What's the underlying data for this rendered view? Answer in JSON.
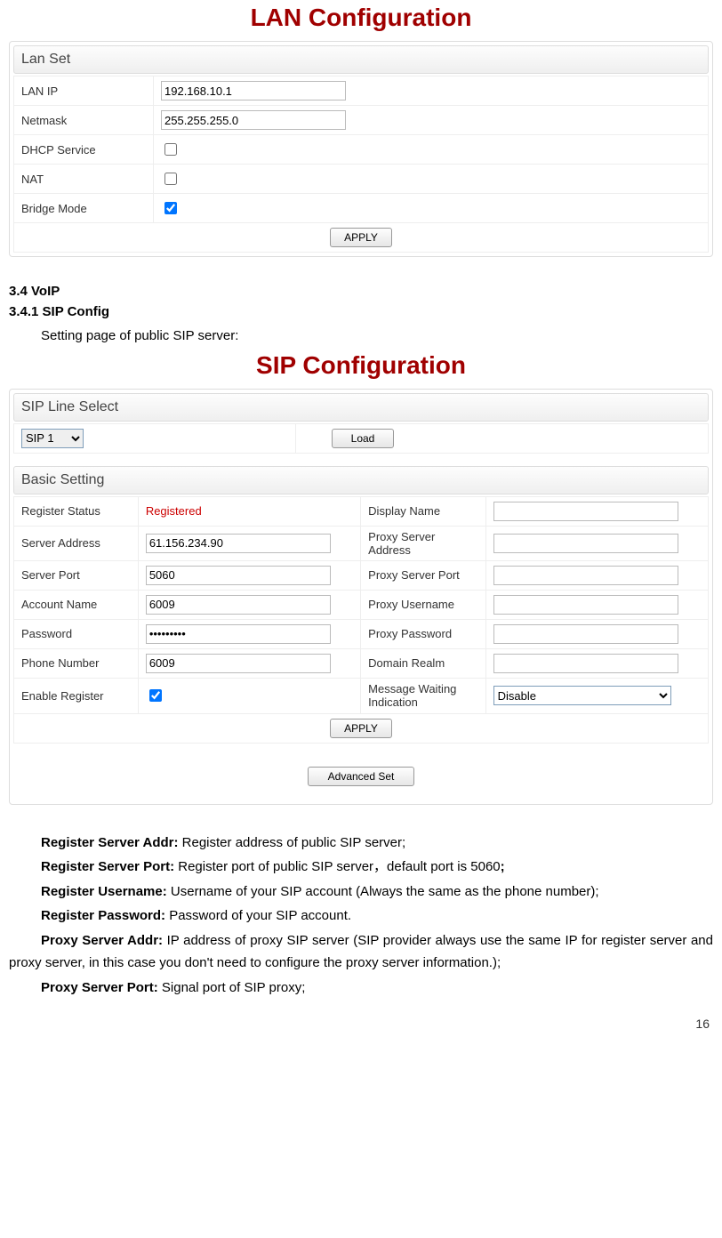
{
  "lan": {
    "title": "LAN Configuration",
    "section": "Lan Set",
    "rows": {
      "lan_ip_label": "LAN IP",
      "lan_ip_value": "192.168.10.1",
      "netmask_label": "Netmask",
      "netmask_value": "255.255.255.0",
      "dhcp_label": "DHCP Service",
      "nat_label": "NAT",
      "bridge_label": "Bridge Mode"
    },
    "apply": "APPLY"
  },
  "headings": {
    "h34": "3.4 VoIP",
    "h341": "3.4.1 SIP Config",
    "h341_sub": "Setting page of public SIP server:"
  },
  "sip": {
    "title": "SIP Configuration",
    "line_select_section": "SIP Line Select",
    "sip_select_value": "SIP 1",
    "load_btn": "Load",
    "basic_section": "Basic Setting",
    "left": {
      "register_status_label": "Register Status",
      "register_status_value": "Registered",
      "server_address_label": "Server Address",
      "server_address_value": "61.156.234.90",
      "server_port_label": "Server Port",
      "server_port_value": "5060",
      "account_name_label": "Account Name",
      "account_name_value": "6009",
      "password_label": "Password",
      "password_value": "•••••••••",
      "phone_number_label": "Phone Number",
      "phone_number_value": "6009",
      "enable_register_label": "Enable Register"
    },
    "right": {
      "display_name_label": "Display Name",
      "display_name_value": "",
      "proxy_server_addr_label": "Proxy Server Address",
      "proxy_server_addr_value": "",
      "proxy_server_port_label": "Proxy Server Port",
      "proxy_server_port_value": "",
      "proxy_username_label": "Proxy Username",
      "proxy_username_value": "",
      "proxy_password_label": "Proxy Password",
      "proxy_password_value": "",
      "domain_realm_label": "Domain Realm",
      "domain_realm_value": "",
      "mwi_label": "Message Waiting Indication",
      "mwi_value": "Disable"
    },
    "apply": "APPLY",
    "advanced": "Advanced Set"
  },
  "desc": {
    "reg_addr_b": "Register Server Addr:",
    "reg_addr_t": "  Register address of public SIP server;",
    "reg_port_b": "Register Server Port:",
    "reg_port_t": "  Register port of public SIP server，default port is 5060",
    "reg_port_semi": ";",
    "reg_user_b": "Register Username:",
    "reg_user_t": "  Username of your SIP account (Always the same as the phone number);",
    "reg_pass_b": "Register Password:",
    "reg_pass_t": " Password of your SIP account.",
    "proxy_addr_b": "Proxy Server Addr:",
    "proxy_addr_t": " IP address of proxy SIP server (SIP provider always use the same IP for register server and proxy server, in this case you don't need to configure the proxy server information.);",
    "proxy_port_b": "Proxy Server Port:",
    "proxy_port_t": " Signal port of SIP proxy;"
  },
  "page_number": "16"
}
